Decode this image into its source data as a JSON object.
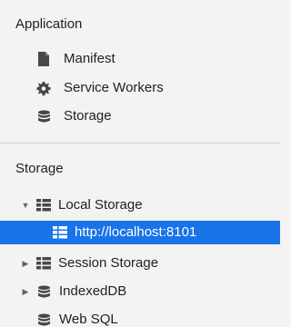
{
  "application": {
    "title": "Application",
    "items": [
      {
        "label": "Manifest",
        "icon": "document-icon"
      },
      {
        "label": "Service Workers",
        "icon": "gear-icon"
      },
      {
        "label": "Storage",
        "icon": "database-icon"
      }
    ]
  },
  "storage": {
    "title": "Storage",
    "items": [
      {
        "label": "Local Storage",
        "icon": "grid-icon",
        "expanded": true
      },
      {
        "label": "http://localhost:8101",
        "icon": "grid-icon",
        "selected": true
      },
      {
        "label": "Session Storage",
        "icon": "grid-icon",
        "expanded": false
      },
      {
        "label": "IndexedDB",
        "icon": "database-icon",
        "expanded": false
      },
      {
        "label": "Web SQL",
        "icon": "database-icon"
      }
    ]
  },
  "colors": {
    "selection": "#1a73e8",
    "background": "#f3f3f3"
  }
}
